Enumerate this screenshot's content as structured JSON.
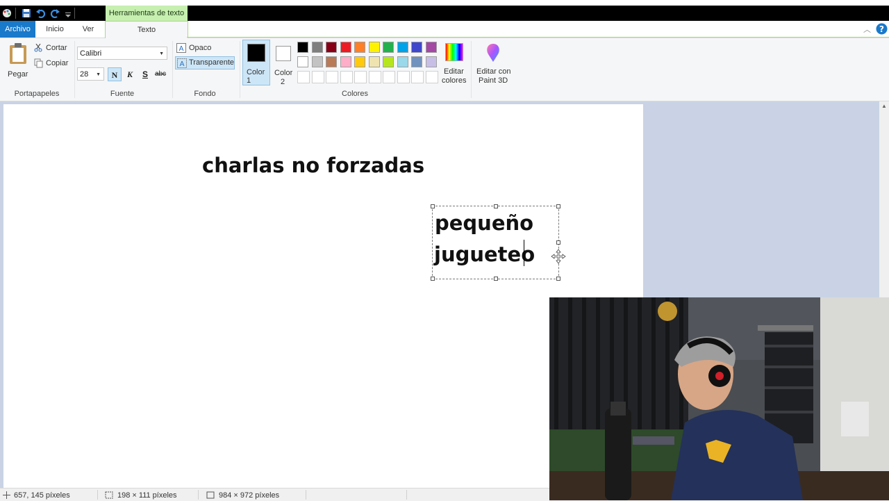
{
  "quick_access": {
    "context_tab_label": "Herramientas de texto"
  },
  "tabs": {
    "file": "Archivo",
    "home": "Inicio",
    "view": "Ver",
    "text": "Texto"
  },
  "clipboard": {
    "paste": "Pegar",
    "cut": "Cortar",
    "copy": "Copiar",
    "group": "Portapapeles"
  },
  "font": {
    "family": "Calibri",
    "size": "28",
    "bold": "N",
    "italic": "K",
    "underline": "S",
    "strikethrough": "abc",
    "group": "Fuente"
  },
  "background": {
    "opaque": "Opaco",
    "transparent": "Transparente",
    "group": "Fondo"
  },
  "colors": {
    "color1_label": "Color 1",
    "color1_num": "1",
    "color2_label": "Color",
    "color2_num": "2",
    "color1": "#000000",
    "color2": "#ffffff",
    "palette_row1": [
      "#000000",
      "#7f7f7f",
      "#880015",
      "#ed1c24",
      "#ff7f27",
      "#fff200",
      "#22b14c",
      "#00a2e8",
      "#3f48cc",
      "#a349a4"
    ],
    "palette_row2": [
      "#ffffff",
      "#c3c3c3",
      "#b97a57",
      "#ffaec9",
      "#ffc90e",
      "#efe4b0",
      "#b5e61d",
      "#99d9ea",
      "#7092be",
      "#c8bfe7"
    ],
    "edit_colors_line1": "Editar",
    "edit_colors_line2": "colores",
    "group": "Colores"
  },
  "paint3d": {
    "line1": "Editar con",
    "line2": "Paint 3D"
  },
  "canvas": {
    "title_text": "charlas no forzadas",
    "box_line1": "pequeño",
    "box_line2": "jugueteo"
  },
  "status": {
    "cursor_pos": "657, 145 píxeles",
    "selection_size": "198 × 111 píxeles",
    "image_size": "984 × 972 píxeles"
  }
}
